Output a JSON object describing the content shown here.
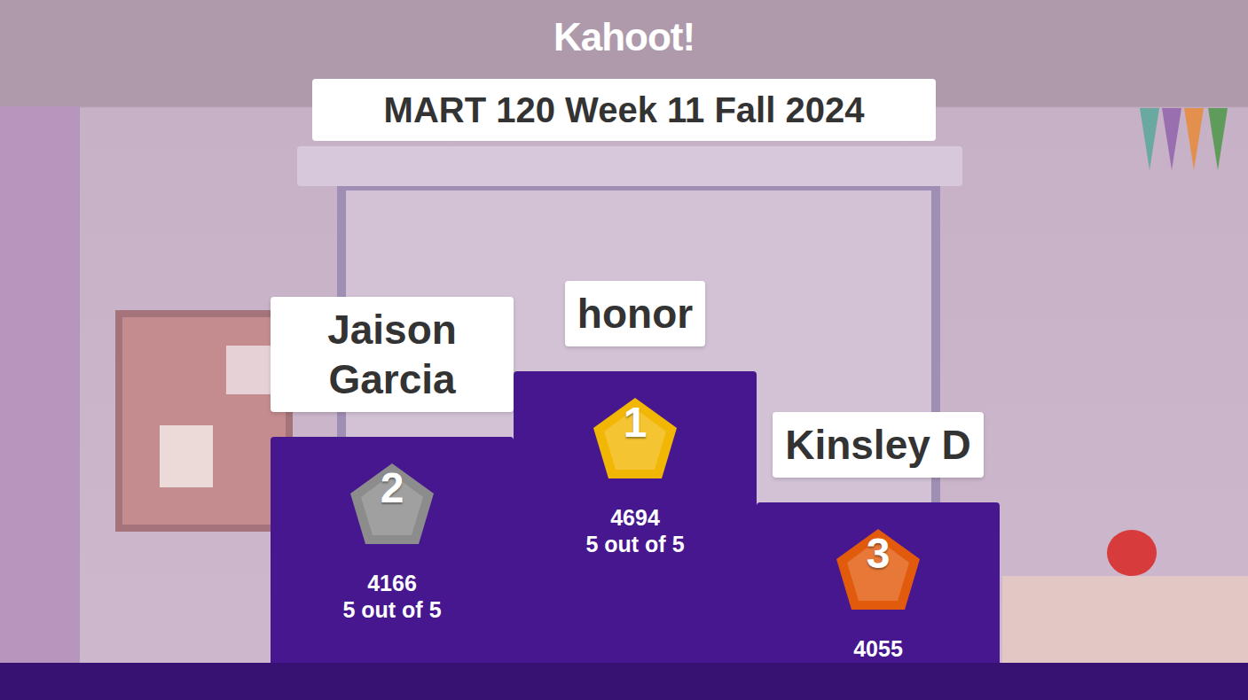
{
  "logo": "Kahoot!",
  "title": "MART 120 Week 11 Fall 2024",
  "podium": [
    {
      "rank": "2",
      "name": "Jaison Garcia",
      "score": "4166",
      "correct": "5 out of 5",
      "color": "#8c8c8c"
    },
    {
      "rank": "1",
      "name": "honor",
      "score": "4694",
      "correct": "5 out of 5",
      "color": "#f2b705"
    },
    {
      "rank": "3",
      "name": "Kinsley D",
      "score": "4055",
      "color": "#e25b0d"
    }
  ]
}
